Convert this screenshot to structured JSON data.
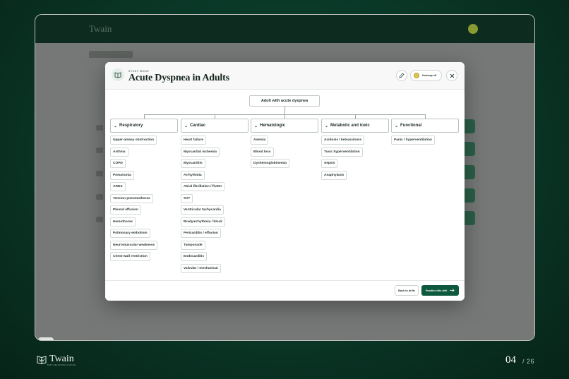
{
  "background_app": {
    "brand": "Twain"
  },
  "modal": {
    "eyebrow": "STUDY MODE",
    "title": "Acute Dyspnea in Adults",
    "heatmap_label": "Heatmap off",
    "root": "Adult with acute dyspnea",
    "categories": [
      {
        "label": "Respiratory",
        "items": [
          "Upper-airway obstruction",
          "Asthma",
          "COPD",
          "Pneumonia",
          "ARDS",
          "Tension pneumothorax",
          "Pleural effusion",
          "Hemothorax",
          "Pulmonary embolism",
          "Neuromuscular weakness",
          "Chest-wall restriction"
        ]
      },
      {
        "label": "Cardiac",
        "items": [
          "Heart failure",
          "Myocardial ischemia",
          "Myocarditis",
          "Arrhythmia",
          "Atrial fibrillation / flutter",
          "SVT",
          "Ventricular tachycardia",
          "Bradyarrhythmia / block",
          "Pericarditis / effusion",
          "Tamponade",
          "Endocarditis",
          "Valvular / mechanical"
        ]
      },
      {
        "label": "Hematologic",
        "items": [
          "Anemia",
          "Blood loss",
          "Dyshemoglobinemia"
        ]
      },
      {
        "label": "Metabolic and toxic",
        "items": [
          "Acidosis / ketoacidosis",
          "Toxic hyperventilation",
          "Sepsis",
          "Anaphylaxis"
        ]
      },
      {
        "label": "Functional",
        "items": [
          "Panic / hyperventilation"
        ]
      }
    ],
    "footer": {
      "back_label": "Back to drills",
      "practice_label": "Practice this drill"
    }
  },
  "footer_brand": {
    "name": "Twain",
    "tagline": "BEST REASONING CLINICAL"
  },
  "pagination": {
    "current": "04",
    "total": "/ 26"
  },
  "colors": {
    "brand_green": "#0f5a3f",
    "background": "#0a3626",
    "heatmap_dot": "#d9c64f"
  }
}
